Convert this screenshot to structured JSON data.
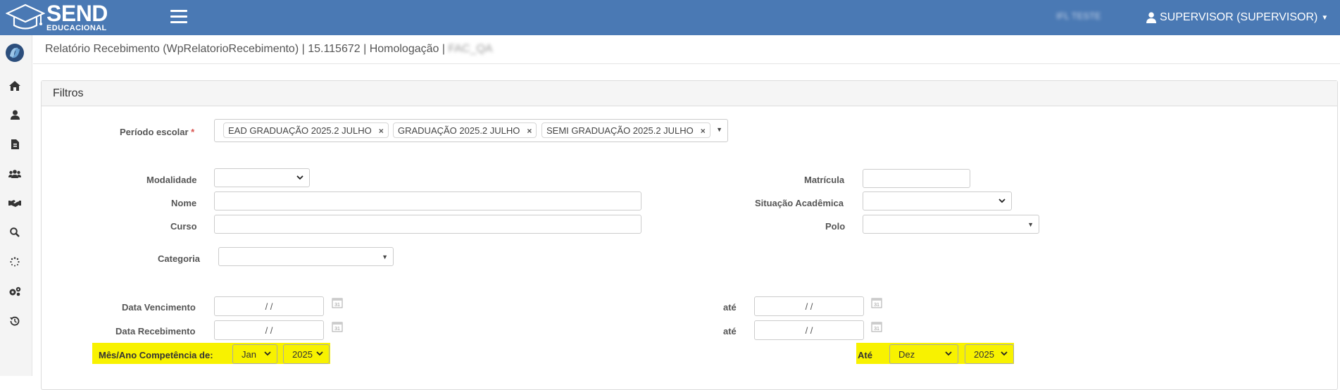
{
  "topbar": {
    "logo_send": "SEND",
    "logo_edu": "EDUCACIONAL",
    "env_label": "IFL TESTE",
    "user": "SUPERVISOR (SUPERVISOR)"
  },
  "sidebar": {
    "items": [
      "home-icon",
      "user-icon",
      "document-icon",
      "users-icon",
      "handshake-icon",
      "search-icon",
      "spinner-icon",
      "gears-icon",
      "history-icon"
    ]
  },
  "breadcrumb": {
    "text": "Relatório Recebimento (WpRelatorioRecebimento) | 15.115672 | Homologação | ",
    "blurred": "FAC_QA"
  },
  "panel": {
    "title": "Filtros"
  },
  "form": {
    "periodo_label": "Período escolar",
    "periodo_required": "*",
    "periodo_tags": [
      "EAD GRADUAÇÃO 2025.2 JULHO",
      "GRADUAÇÃO 2025.2 JULHO",
      "SEMI GRADUAÇÃO 2025.2 JULHO"
    ],
    "modalidade_label": "Modalidade",
    "modalidade_value": "",
    "nome_label": "Nome",
    "nome_value": "",
    "curso_label": "Curso",
    "curso_value": "",
    "categoria_label": "Categoria",
    "categoria_value": "",
    "matricula_label": "Matrícula",
    "matricula_value": "",
    "situacao_label": "Situação Acadêmica",
    "situacao_value": "",
    "polo_label": "Polo",
    "polo_value": "",
    "data_vencimento_label": "Data Vencimento",
    "data_recebimento_label": "Data Recebimento",
    "ate_label": "até",
    "date_placeholder": " /  / ",
    "competencia_label": "Mês/Ano Competência de:",
    "competencia_mes_de": "Jan",
    "competencia_ano_de": "2025",
    "competencia_ate_label": "Até",
    "competencia_mes_ate": "Dez",
    "competencia_ano_ate": "2025"
  },
  "colors": {
    "topbar": "#4a79b4",
    "highlight": "#f8f200",
    "required": "#d9534f"
  }
}
